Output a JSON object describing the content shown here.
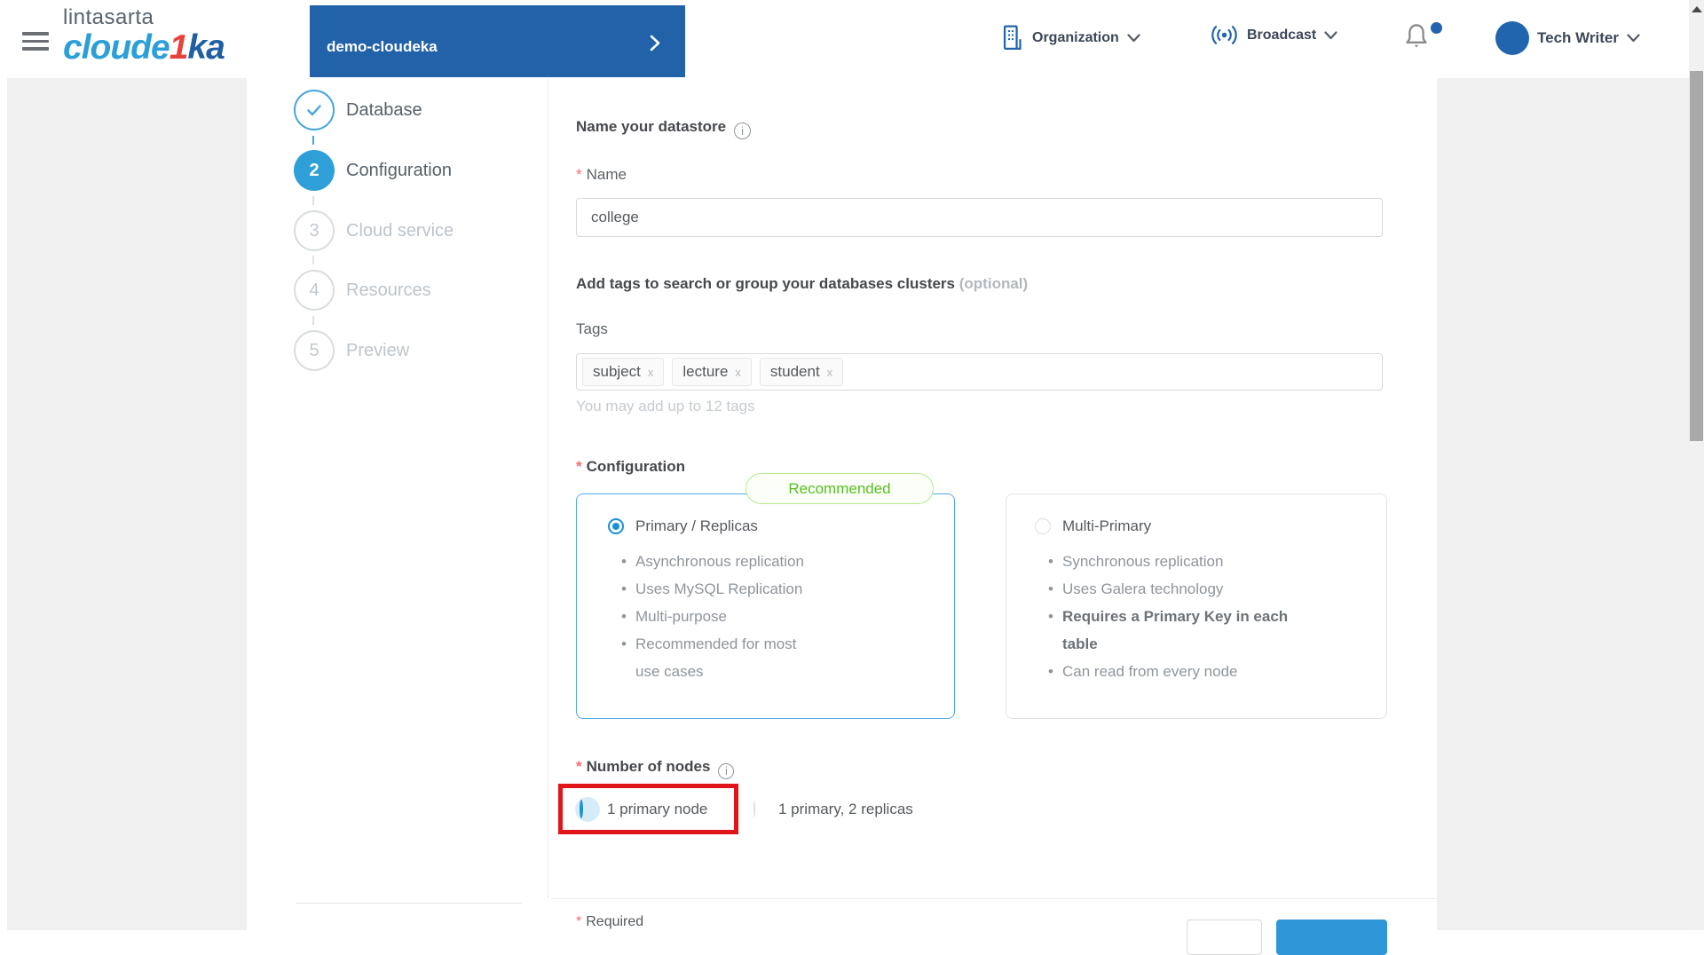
{
  "header": {
    "logo": {
      "line1": "lintasarta",
      "brand_pre": "cloude",
      "brand_accent": "1",
      "brand_post": "ka"
    },
    "project": {
      "name": "demo-cloudeka"
    },
    "organization_label": "Organization",
    "broadcast_label": "Broadcast",
    "user_name": "Tech Writer"
  },
  "stepper": {
    "steps": [
      {
        "num": "",
        "label": "Database"
      },
      {
        "num": "2",
        "label": "Configuration"
      },
      {
        "num": "3",
        "label": "Cloud service"
      },
      {
        "num": "4",
        "label": "Resources"
      },
      {
        "num": "5",
        "label": "Preview"
      }
    ]
  },
  "form": {
    "name_section": {
      "heading": "Name your datastore",
      "field_label": "Name",
      "value": "college"
    },
    "tags_section": {
      "heading": "Add tags to search or group your databases clusters",
      "optional_note": "(optional)",
      "field_label": "Tags",
      "tags": [
        "subject",
        "lecture",
        "student"
      ],
      "hint": "You may add up to 12 tags"
    },
    "config_section": {
      "field_label": "Configuration",
      "badge": "Recommended",
      "options": [
        {
          "title": "Primary / Replicas",
          "bullets": [
            "Asynchronous replication",
            "Uses MySQL Replication",
            "Multi-purpose",
            "Recommended for most use cases"
          ]
        },
        {
          "title": "Multi-Primary",
          "bullets": [
            "Synchronous replication",
            "Uses Galera technology",
            "Requires a Primary Key in each table",
            "Can read from every node"
          ]
        }
      ]
    },
    "nodes_section": {
      "field_label": "Number of nodes",
      "options": [
        {
          "label": "1 primary node"
        },
        {
          "label": "1 primary, 2 replicas"
        }
      ]
    },
    "footer": {
      "required_note": "Required"
    }
  },
  "icons": {
    "info_glyph": "i",
    "tag_remove_glyph": "x",
    "required_asterisk": "*"
  },
  "colors": {
    "brand_blue": "#2262a9",
    "accent_blue": "#2f9fd8",
    "selected_border": "#4faae2",
    "recommended_green": "#57c11e",
    "annotation_red": "#e1141a"
  }
}
